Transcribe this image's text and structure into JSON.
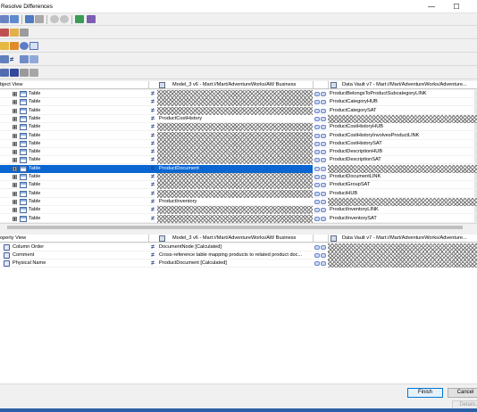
{
  "window": {
    "title": "Resolve Differences",
    "minimize": "—",
    "maximize": "☐"
  },
  "object_view": {
    "headers": {
      "col1": "bject View",
      "col2": "Model_3 v6 - Mart://Mart/AdventureWorks/AW Business",
      "col3": "Data Vault v7 - Mart://Mart/AdventureWorks/Adventure..."
    },
    "rows": [
      {
        "type": "Table",
        "left": "",
        "right": "ProductBelongsToProductSubcategoryLINK",
        "left_hatch": true,
        "right_hatch": false,
        "selected": false
      },
      {
        "type": "Table",
        "left": "",
        "right": "ProductCategoryHUB",
        "left_hatch": true,
        "right_hatch": false,
        "selected": false
      },
      {
        "type": "Table",
        "left": "",
        "right": "ProductCategorySAT",
        "left_hatch": true,
        "right_hatch": false,
        "selected": false
      },
      {
        "type": "Table",
        "left": "ProductCostHistory",
        "right": "",
        "left_hatch": false,
        "right_hatch": true,
        "selected": false
      },
      {
        "type": "Table",
        "left": "",
        "right": "ProductCostHistoryHUB",
        "left_hatch": true,
        "right_hatch": false,
        "selected": false
      },
      {
        "type": "Table",
        "left": "",
        "right": "ProductCostHistoryInvolvesProductLINK",
        "left_hatch": true,
        "right_hatch": false,
        "selected": false
      },
      {
        "type": "Table",
        "left": "",
        "right": "ProductCostHistorySAT",
        "left_hatch": true,
        "right_hatch": false,
        "selected": false
      },
      {
        "type": "Table",
        "left": "",
        "right": "ProductDescriptionHUB",
        "left_hatch": true,
        "right_hatch": false,
        "selected": false
      },
      {
        "type": "Table",
        "left": "",
        "right": "ProductDescriptionSAT",
        "left_hatch": true,
        "right_hatch": false,
        "selected": false
      },
      {
        "type": "Table",
        "left": "ProductDocument",
        "right": "",
        "left_hatch": false,
        "right_hatch": true,
        "selected": true
      },
      {
        "type": "Table",
        "left": "",
        "right": "ProductDocumentLINK",
        "left_hatch": true,
        "right_hatch": false,
        "selected": false
      },
      {
        "type": "Table",
        "left": "",
        "right": "ProductGroupSAT",
        "left_hatch": true,
        "right_hatch": false,
        "selected": false
      },
      {
        "type": "Table",
        "left": "",
        "right": "ProductHUB",
        "left_hatch": true,
        "right_hatch": false,
        "selected": false
      },
      {
        "type": "Table",
        "left": "ProductInventory",
        "right": "",
        "left_hatch": false,
        "right_hatch": true,
        "selected": false
      },
      {
        "type": "Table",
        "left": "",
        "right": "ProductInventoryLINK",
        "left_hatch": true,
        "right_hatch": false,
        "selected": false
      },
      {
        "type": "Table",
        "left": "",
        "right": "ProductInventorySAT",
        "left_hatch": true,
        "right_hatch": false,
        "selected": false
      }
    ]
  },
  "property_view": {
    "headers": {
      "col1": "operty View",
      "col2": "Model_3 v6 - Mart://Mart/AdventureWorks/AW Business",
      "col3": "Data Vault v7 - Mart://Mart/AdventureWorks/Adventure..."
    },
    "rows": [
      {
        "name": "Column Order",
        "left": "DocumentNode [Calculated]"
      },
      {
        "name": "Comment",
        "left": "Cross-reference table mapping products to related product doc..."
      },
      {
        "name": "Physical Name",
        "left": "ProductDocument [Calculated]"
      }
    ]
  },
  "buttons": {
    "finish": "Finish",
    "cancel": "Cancel",
    "details": "Details..."
  },
  "icons": [
    "table-icon",
    "not-equal-icon",
    "copy-arrows-icon",
    "property-icon",
    "database-model-icon"
  ]
}
